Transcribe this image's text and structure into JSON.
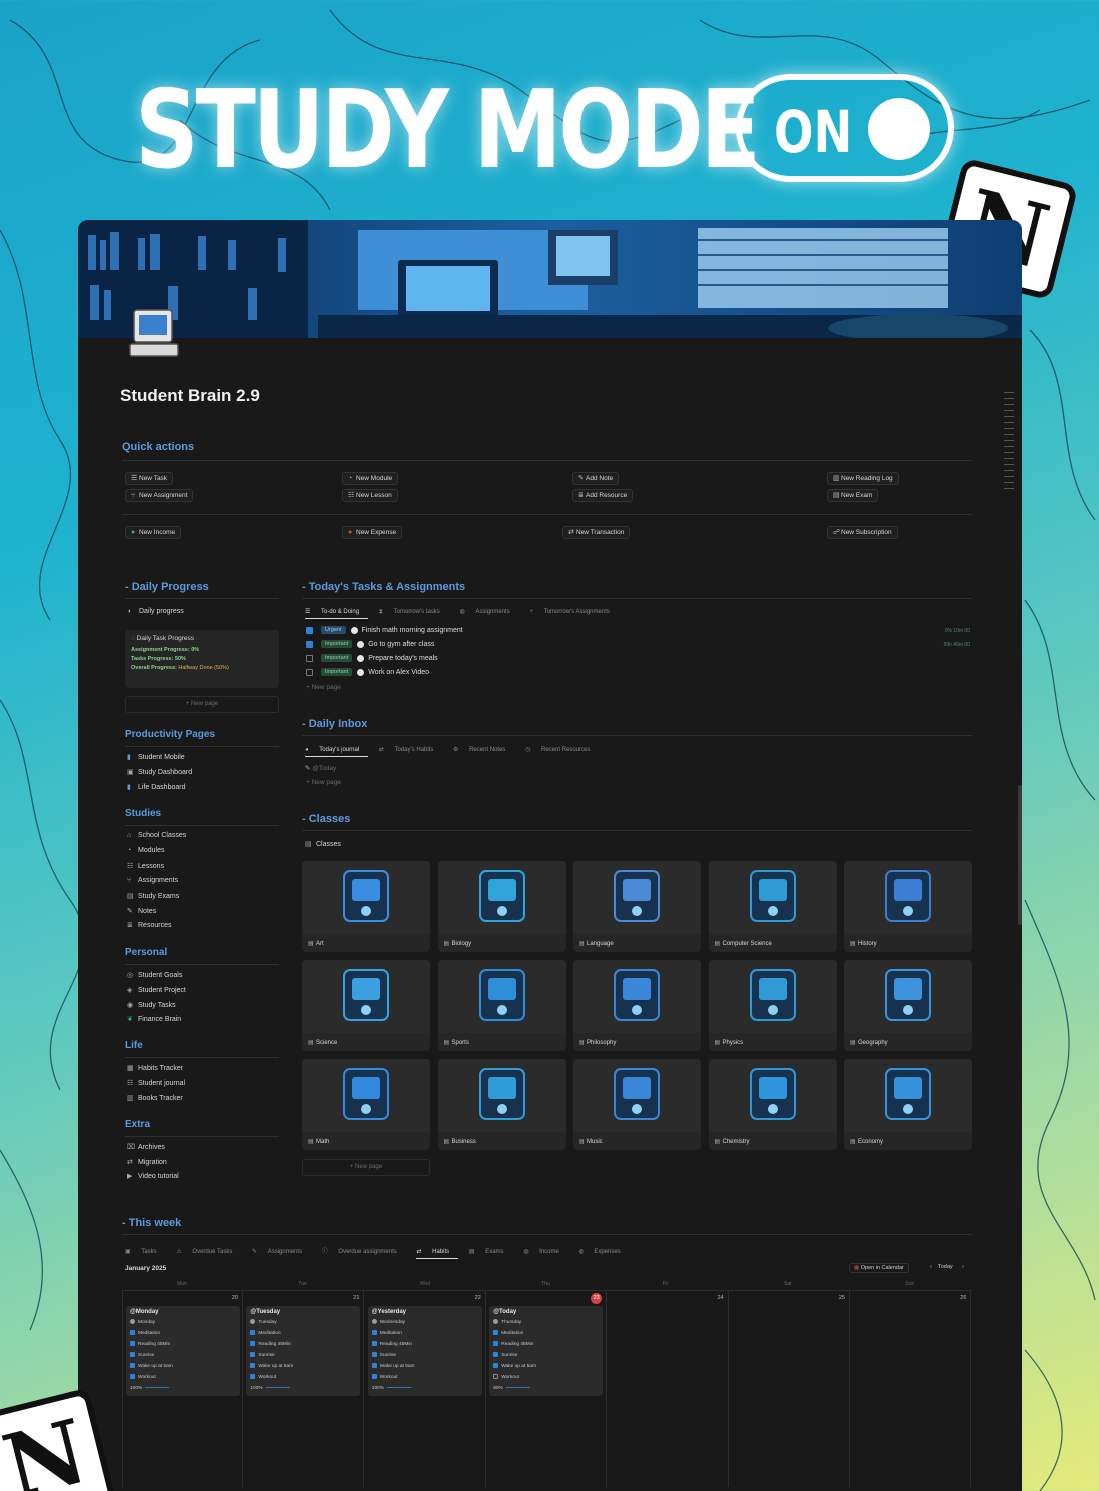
{
  "banner": {
    "title": "STUDY MODE",
    "toggle_label": "ON",
    "toggle_state": "on",
    "logo_letter": "N"
  },
  "page": {
    "title": "Student Brain 2.9"
  },
  "quick_actions": {
    "heading": "Quick actions",
    "rows": [
      [
        {
          "label": "New Task",
          "icon": "list-icon"
        },
        {
          "label": "New Module",
          "icon": "pie-icon"
        },
        {
          "label": "Add Note",
          "icon": "edit-icon"
        },
        {
          "label": "New Reading Log",
          "icon": "book-icon"
        }
      ],
      [
        {
          "label": "New Assignment",
          "icon": "fork-icon"
        },
        {
          "label": "New Lesson",
          "icon": "checklist-icon"
        },
        {
          "label": "Add Resource",
          "icon": "stack-icon"
        },
        {
          "label": "New Exam",
          "icon": "doc-icon"
        }
      ],
      [
        {
          "label": "New Income",
          "icon": "income-dot-icon"
        },
        {
          "label": "New Expense",
          "icon": "expense-dot-icon"
        },
        {
          "label": "New Transaction",
          "icon": "swap-icon"
        },
        {
          "label": "New Subscription",
          "icon": "people-icon"
        }
      ]
    ]
  },
  "daily_progress": {
    "heading": "- Daily Progress",
    "view_label": "Daily progress",
    "card_title": "Daily Task Progress",
    "assignment_progress": "Assignment Progress: 0%",
    "tasks_progress": "Tasks Progress: 50%",
    "overall_label": "Overall Progress:",
    "overall_value": "Halfway Done (50%)",
    "new_page": "+ New page"
  },
  "sidebar": {
    "sections": [
      {
        "heading": "Productivity Pages",
        "items": [
          "Student Mobile",
          "Study Dashboard",
          "Life Dashboard"
        ]
      },
      {
        "heading": "Studies",
        "items": [
          "School Classes",
          "Modules",
          "Lessons",
          "Assignments",
          "Study Exams",
          "Notes",
          "Resources"
        ]
      },
      {
        "heading": "Personal",
        "items": [
          "Student Goals",
          "Student Project",
          "Study Tasks",
          "Finance Brain"
        ]
      },
      {
        "heading": "Life",
        "items": [
          "Habits Tracker",
          "Student journal",
          "Books Tracker"
        ]
      },
      {
        "heading": "Extra",
        "items": [
          "Archives",
          "Migration",
          "Video tutorial"
        ]
      }
    ]
  },
  "tasks": {
    "heading": "- Today's Tasks & Assignments",
    "tabs": [
      "To-do & Doing",
      "Tomorrow's tasks",
      "Assignments",
      "Tomorrow's Assignments"
    ],
    "rows": [
      {
        "checked": true,
        "tag": "Urgent",
        "tag_type": "urgent",
        "text": "Finish math morning assignment",
        "time": "0% 10m 00"
      },
      {
        "checked": true,
        "tag": "Important",
        "tag_type": "important",
        "text": "Go to gym after class",
        "time": "99h 40m 00"
      },
      {
        "checked": false,
        "tag": "Important",
        "tag_type": "important",
        "text": "Prepare today's meals",
        "time": ""
      },
      {
        "checked": false,
        "tag": "Important",
        "tag_type": "important",
        "text": "Work on Alex Video",
        "time": ""
      }
    ],
    "new_page": "+ New page"
  },
  "inbox": {
    "heading": "- Daily Inbox",
    "tabs": [
      "Today's journal",
      "Today's Habits",
      "Recent Notes",
      "Recent Resources"
    ],
    "entry": "@Today",
    "new_page": "+ New page"
  },
  "classes": {
    "heading": "- Classes",
    "view_label": "Classes",
    "items": [
      "Art",
      "Biology",
      "Language",
      "Computer Science",
      "History",
      "Science",
      "Sports",
      "Philosophy",
      "Physics",
      "Geography",
      "Math",
      "Business",
      "Music",
      "Chemistry",
      "Economy"
    ],
    "new_page": "+ New page"
  },
  "week": {
    "heading": "- This week",
    "tabs": [
      "Tasks",
      "Overdue Tasks",
      "Assignments",
      "Overdue assignments",
      "Habits",
      "Exams",
      "Income",
      "Expenses"
    ],
    "active_tab": "Habits",
    "month": "January 2025",
    "open_calendar": "Open in Calendar",
    "today_btn": "Today",
    "weekdays": [
      "Mon",
      "Tue",
      "Wed",
      "Thu",
      "Fri",
      "Sat",
      "Sun"
    ],
    "dates": [
      "20",
      "21",
      "22",
      "23",
      "24",
      "25",
      "26"
    ],
    "today_index": 3,
    "days": [
      {
        "title": "@Monday",
        "day": "Monday",
        "habits": [
          [
            "Meditation",
            true
          ],
          [
            "Reading 45Min",
            true
          ],
          [
            "Sunrise",
            true
          ],
          [
            "Wake up at 5am",
            true
          ],
          [
            "Workout",
            true
          ]
        ],
        "progress": "100%"
      },
      {
        "title": "@Tuesday",
        "day": "Tuesday",
        "habits": [
          [
            "Meditation",
            true
          ],
          [
            "Reading 45Min",
            true
          ],
          [
            "Sunrise",
            true
          ],
          [
            "Wake up at 5am",
            true
          ],
          [
            "Workout",
            true
          ]
        ],
        "progress": "100%"
      },
      {
        "title": "@Yesterday",
        "day": "Wednesday",
        "habits": [
          [
            "Meditation",
            true
          ],
          [
            "Reading 45Min",
            true
          ],
          [
            "Sunrise",
            true
          ],
          [
            "Wake up at 5am",
            true
          ],
          [
            "Workout",
            true
          ]
        ],
        "progress": "100%"
      },
      {
        "title": "@Today",
        "day": "Thursday",
        "habits": [
          [
            "Meditation",
            true
          ],
          [
            "Reading 45Min",
            true
          ],
          [
            "Sunrise",
            true
          ],
          [
            "Wake up at 5am",
            true
          ],
          [
            "Workout",
            false
          ]
        ],
        "progress": "80%"
      }
    ]
  },
  "colors": {
    "accent": "#5b9bdd",
    "page_bg": "#191919",
    "checkbox_on": "#2f83d6",
    "today_badge": "#d64040"
  }
}
